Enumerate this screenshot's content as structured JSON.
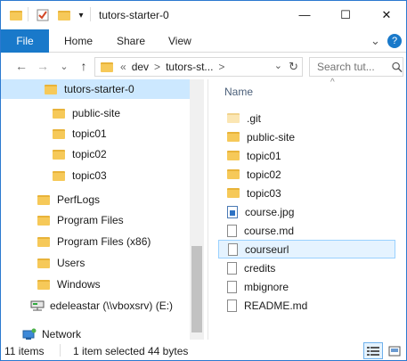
{
  "window": {
    "title": "tutors-starter-0",
    "minimize_glyph": "—",
    "maximize_glyph": "☐",
    "close_glyph": "✕"
  },
  "ribbon": {
    "tabs": [
      "File",
      "Home",
      "Share",
      "View"
    ],
    "expand_glyph": "⌄",
    "help_glyph": "?"
  },
  "nav": {
    "back_glyph": "←",
    "forward_glyph": "→",
    "recent_glyph": "⌄",
    "up_glyph": "↑",
    "breadcrumb": [
      "«",
      "dev",
      ">",
      "tutors-st...",
      ">"
    ],
    "address_dropdown": "⌄",
    "refresh_glyph": "↻",
    "search_placeholder": "Search tut...",
    "search_icon": "search-icon"
  },
  "tree": {
    "items": [
      {
        "label": "tutors-starter-0",
        "indent": 2,
        "selected": true
      },
      {
        "label": "public-site",
        "indent": 3
      },
      {
        "label": "topic01",
        "indent": 3
      },
      {
        "label": "topic02",
        "indent": 3
      },
      {
        "label": "topic03",
        "indent": 3
      },
      {
        "label": "PerfLogs",
        "indent": 1
      },
      {
        "label": "Program Files",
        "indent": 1
      },
      {
        "label": "Program Files (x86)",
        "indent": 1
      },
      {
        "label": "Users",
        "indent": 1
      },
      {
        "label": "Windows",
        "indent": 1
      },
      {
        "label": "edeleastar (\\\\vboxsrv) (E:)",
        "indent": 1,
        "icon": "network-drive-icon"
      },
      {
        "label": "Network",
        "indent": 0,
        "icon": "network-icon"
      }
    ]
  },
  "content": {
    "column_name": "Name",
    "sort_glyph": "^",
    "files": [
      {
        "name": ".git",
        "type": "folder-faded"
      },
      {
        "name": "public-site",
        "type": "folder"
      },
      {
        "name": "topic01",
        "type": "folder"
      },
      {
        "name": "topic02",
        "type": "folder"
      },
      {
        "name": "topic03",
        "type": "folder"
      },
      {
        "name": "course.jpg",
        "type": "image"
      },
      {
        "name": "course.md",
        "type": "doc"
      },
      {
        "name": "courseurl",
        "type": "doc",
        "selected": true
      },
      {
        "name": "credits",
        "type": "doc"
      },
      {
        "name": "mbignore",
        "type": "doc"
      },
      {
        "name": "README.md",
        "type": "doc"
      }
    ]
  },
  "status": {
    "items_count": "11 items",
    "selected": "1 item selected",
    "size": "44 bytes"
  },
  "colors": {
    "accent": "#1979ca",
    "selection": "#cce8ff",
    "folder": "#f6c959"
  }
}
